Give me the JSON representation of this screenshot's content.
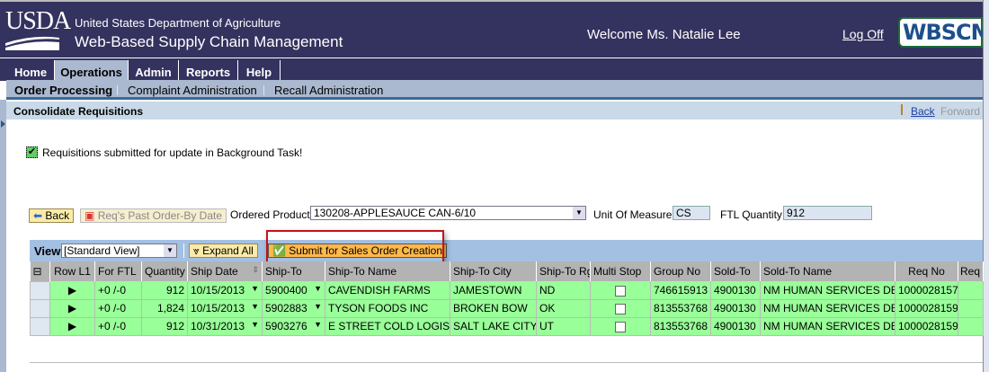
{
  "header": {
    "logo_text": "USDA",
    "org": "United States Department of Agriculture",
    "app_title": "Web-Based Supply Chain Management",
    "welcome": "Welcome Ms. Natalie Lee",
    "logoff": "Log Off",
    "brand_logo": "WBSCM"
  },
  "tabs": [
    {
      "label": "Home"
    },
    {
      "label": "Operations",
      "active": true
    },
    {
      "label": "Admin"
    },
    {
      "label": "Reports"
    },
    {
      "label": "Help"
    }
  ],
  "subnav": [
    {
      "label": "Order Processing",
      "active": true
    },
    {
      "label": "Complaint Administration"
    },
    {
      "label": "Recall Administration"
    }
  ],
  "page": {
    "title": "Consolidate Requisitions",
    "back": "Back",
    "forward": "Forward"
  },
  "message": {
    "icon": "success-check-icon",
    "text": "Requisitions submitted for update in Background Task!"
  },
  "toolbar": {
    "back": "Back",
    "past_order": "Req's Past Order-By Date",
    "ordered_product_label": "Ordered Product:",
    "ordered_product": "130208-APPLESAUCE CAN-6/10",
    "uom_label": "Unit Of Measure:",
    "uom": "CS",
    "ftl_label": "FTL Quantity:",
    "ftl": "912"
  },
  "grid_toolbar": {
    "view_label": "View",
    "view_value": "[Standard View]",
    "expand_all": "Expand All",
    "submit": "Submit for Sales Order Creation"
  },
  "table": {
    "columns": [
      "Row L1",
      "For FTL",
      "Quantity",
      "Ship Date",
      "Ship-To",
      "Ship-To Name",
      "Ship-To City",
      "Ship-To Rg",
      "Multi Stop",
      "Group No",
      "Sold-To",
      "Sold-To Name",
      "Req No",
      "Req"
    ],
    "rows": [
      {
        "ftl": "+0 /-0",
        "qty": "912",
        "date": "10/15/2013",
        "shipto": "5900400",
        "name": "CAVENDISH FARMS",
        "city": "JAMESTOWN",
        "rg": "ND",
        "multi": false,
        "group": "746615913",
        "soldto": "4900130",
        "soldname": "NM HUMAN SERVICES DEPT",
        "req": "1000028157"
      },
      {
        "ftl": "+0 /-0",
        "qty": "1,824",
        "date": "10/15/2013",
        "shipto": "5902883",
        "name": "TYSON FOODS INC",
        "city": "BROKEN BOW",
        "rg": "OK",
        "multi": false,
        "group": "813553768",
        "soldto": "4900130",
        "soldname": "NM HUMAN SERVICES DEPT",
        "req": "1000028159"
      },
      {
        "ftl": "+0 /-0",
        "qty": "912",
        "date": "10/31/2013",
        "shipto": "5903276",
        "name": "E STREET COLD LOGISTIC",
        "city": "SALT LAKE CITY",
        "rg": "UT",
        "multi": false,
        "group": "813553768",
        "soldto": "4900130",
        "soldname": "NM HUMAN SERVICES DEPT",
        "req": "1000028159"
      }
    ]
  },
  "colors": {
    "header": "#34325f",
    "row_green": "#99ff99",
    "highlight": "#c0141c"
  }
}
